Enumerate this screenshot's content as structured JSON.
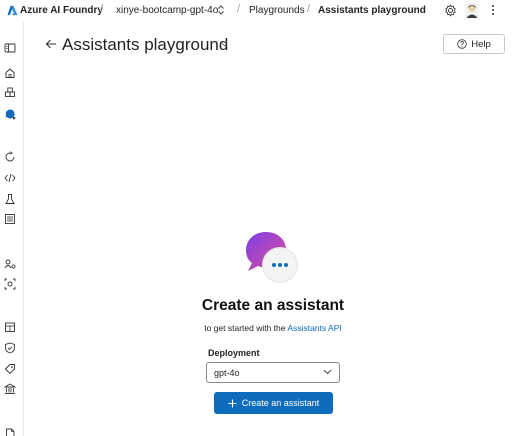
{
  "topbar": {
    "brand": "Azure AI Foundry",
    "project": "xinye-bootcamp-gpt-4o",
    "crumbs": [
      "Playgrounds",
      "Assistants playground"
    ],
    "separator": "/"
  },
  "header": {
    "title": "Assistants playground",
    "help_label": "Help"
  },
  "empty_state": {
    "title": "Create an assistant",
    "subtitle_prefix": "to get started with the ",
    "subtitle_link": "Assistants API"
  },
  "deployment": {
    "label": "Deployment",
    "selected": "gpt-4o"
  },
  "cta": {
    "label": "Create an assistant"
  },
  "icons": {
    "rail": [
      "panel-toggle-icon",
      "home-icon",
      "models-icon",
      "chat-icon",
      "fine-tune-icon",
      "code-icon",
      "eval-icon",
      "tracing-icon",
      "agents-icon",
      "vision-icon",
      "safety-icon",
      "tag-icon",
      "governance-icon",
      "doc-icon"
    ]
  },
  "colors": {
    "accent": "#0f6cbd",
    "text": "#242424"
  }
}
